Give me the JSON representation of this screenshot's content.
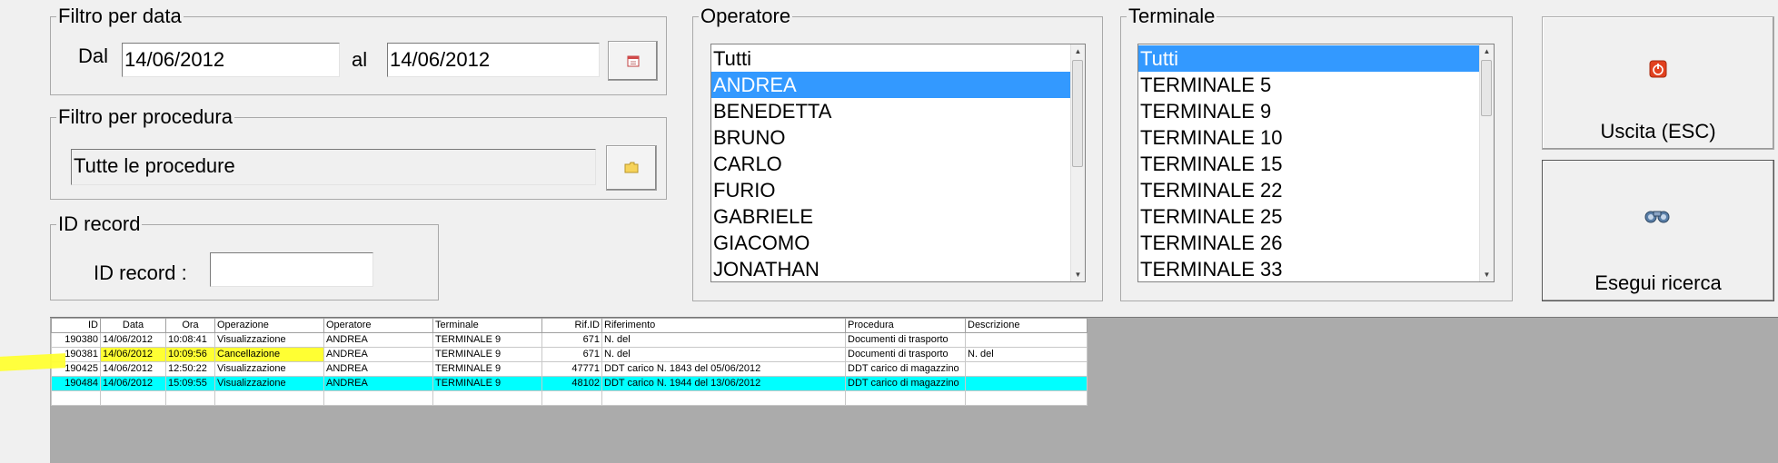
{
  "date_filter": {
    "title": "Filtro per data",
    "from_label": "Dal",
    "from_value": "14/06/2012",
    "to_label": "al",
    "to_value": "14/06/2012",
    "calendar_icon": "calendar-icon"
  },
  "procedure_filter": {
    "title": "Filtro per procedura",
    "value": "Tutte le procedure",
    "folder_icon": "folder-icon"
  },
  "record_filter": {
    "title": "ID record",
    "label": "ID record :",
    "value": ""
  },
  "operator": {
    "title": "Operatore",
    "items": [
      "Tutti",
      "ANDREA",
      "BENEDETTA",
      "BRUNO",
      "CARLO",
      "FURIO",
      "GABRIELE",
      "GIACOMO",
      "JONATHAN"
    ],
    "selected": "ANDREA"
  },
  "terminal": {
    "title": "Terminale",
    "items": [
      "Tutti",
      "TERMINALE 5",
      "TERMINALE 9",
      "TERMINALE 10",
      "TERMINALE 15",
      "TERMINALE 22",
      "TERMINALE 25",
      "TERMINALE 26",
      "TERMINALE 33"
    ],
    "selected": "Tutti"
  },
  "buttons": {
    "exit_label": "Uscita (ESC)",
    "exit_icon": "power-icon",
    "search_label": "Esegui ricerca",
    "search_icon": "binoculars-icon"
  },
  "results": {
    "columns": [
      "ID",
      "Data",
      "Ora",
      "Operazione",
      "Operatore",
      "Terminale",
      "Rif.ID",
      "Riferimento",
      "Procedura",
      "Descrizione"
    ],
    "rows": [
      [
        "190380",
        "14/06/2012",
        "10:08:41",
        "Visualizzazione",
        "ANDREA",
        "TERMINALE 9",
        "671",
        "N. del",
        "Documenti di trasporto",
        ""
      ],
      [
        "190381",
        "14/06/2012",
        "10:09:56",
        "Cancellazione",
        "ANDREA",
        "TERMINALE 9",
        "671",
        "N. del",
        "Documenti di trasporto",
        "N. del"
      ],
      [
        "190425",
        "14/06/2012",
        "12:50:22",
        "Visualizzazione",
        "ANDREA",
        "TERMINALE 9",
        "47771",
        "DDT carico N. 1843 del 05/06/2012",
        "DDT carico di magazzino",
        ""
      ],
      [
        "190484",
        "14/06/2012",
        "15:09:55",
        "Visualizzazione",
        "ANDREA",
        "TERMINALE 9",
        "48102",
        "DDT carico N. 1944 del 13/06/2012",
        "DDT carico di magazzino",
        ""
      ]
    ]
  },
  "colors": {
    "selection_blue": "#3399ff",
    "highlight_yellow": "#ffff33",
    "highlight_cyan": "#00ffff"
  }
}
